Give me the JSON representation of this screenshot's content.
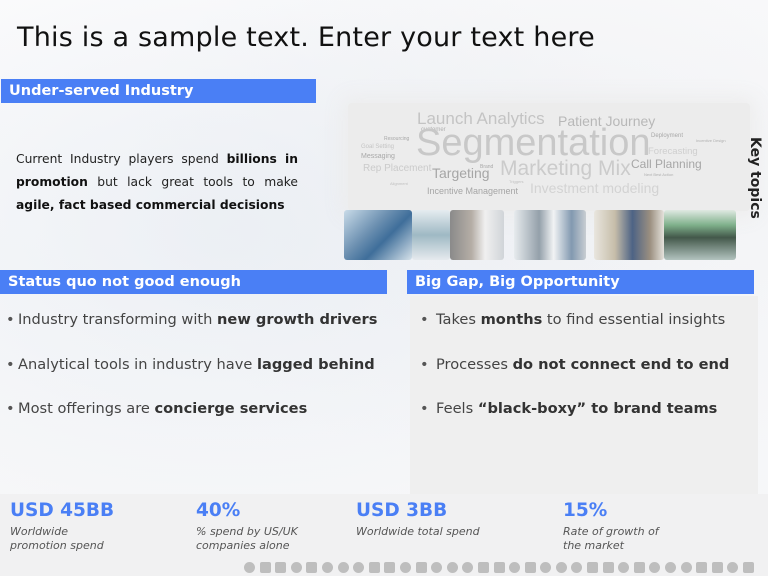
{
  "title": "This is a sample text. Enter your text here",
  "sections": {
    "underserved": {
      "header": "Under-served Industry",
      "text_parts": [
        {
          "text": "Current Industry players spend ",
          "bold": false
        },
        {
          "text": "billions in promotion",
          "bold": true
        },
        {
          "text": " but lack great tools to make ",
          "bold": false
        },
        {
          "text": "agile, fact based commercial  decisions",
          "bold": true
        }
      ]
    },
    "status_quo": {
      "header": "Status quo not good enough",
      "bullets": [
        {
          "plain": "Industry transforming with ",
          "bold": "new growth drivers"
        },
        {
          "plain": "Analytical tools in industry have ",
          "bold": "lagged behind"
        },
        {
          "plain": "Most offerings are ",
          "bold": "concierge services"
        }
      ]
    },
    "big_gap": {
      "header": "Big Gap, Big Opportunity",
      "bullets": [
        {
          "pre": "Takes ",
          "bold": "months",
          "post": " to find essential insights"
        },
        {
          "pre": "Processes ",
          "bold": "do not connect end to end",
          "post": ""
        },
        {
          "pre": "Feels ",
          "bold": "“black-boxy” to brand teams",
          "post": ""
        }
      ]
    }
  },
  "key_topics": {
    "label": "Key topics",
    "words": {
      "segmentation": "Segmentation",
      "launch_analytics": "Launch Analytics",
      "patient_journey": "Patient Journey",
      "marketing_mix": "Marketing Mix",
      "targeting": "Targeting",
      "call_planning": "Call Planning",
      "investment_modeling": "Investment modeling",
      "incentive_management": "Incentive Management",
      "rep_placement": "Rep Placement",
      "forecasting": "Forecasting",
      "messaging": "Messaging",
      "goal_setting": "Goal Setting",
      "resourcing": "Resourcing",
      "customer": "customer",
      "deployment": "Deployment",
      "incentive_design": "Incentive Design",
      "brand": "Brand",
      "alignment": "Alignment",
      "triggers": "Triggers",
      "next_best_action": "Next Best Action"
    },
    "photos": [
      "team-meeting-photo",
      "doctor-consultation-photo",
      "lab-scientist-photo",
      "presentation-meeting-photo",
      "control-room-photo"
    ]
  },
  "stats": [
    {
      "value": "USD 45BB",
      "desc": "Worldwide promotion spend"
    },
    {
      "value": "40%",
      "desc": "% spend by US/UK companies alone"
    },
    {
      "value": "USD 3BB",
      "desc": "Worldwide total spend"
    },
    {
      "value": "15%",
      "desc": "Rate of growth of the market"
    }
  ],
  "colors": {
    "accent": "#4a7ff5",
    "header_text": "#ffffff",
    "wordcloud_text": "#bdbdbd"
  }
}
